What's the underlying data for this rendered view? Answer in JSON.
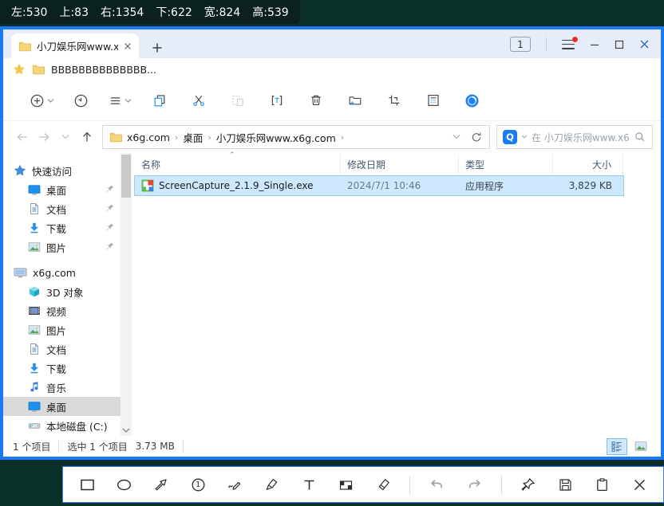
{
  "colors": {
    "background_teal": "#0b3028",
    "window_border_blue": "#1c79f4",
    "selection_row_bg": "#cde8ff",
    "selection_row_border": "#98cef6",
    "accent_icon_blue": "#2e9cf0",
    "search_badge_blue": "#1a7cf2",
    "menu_alert_red": "#e8312a",
    "folder_yellow": "#f6d57a"
  },
  "capture_bar": {
    "parts": [
      "左:530",
      "上:83",
      "右:1354",
      "下:622",
      "宽:824",
      "高:539"
    ]
  },
  "window": {
    "tab": {
      "title": "小刀娱乐网www.x"
    },
    "tab_count_badge": "1",
    "favorites_item": "BBBBBBBBBBBBBB...",
    "toolbar_buttons": [
      {
        "icon": "new-item-icon",
        "chevron": true
      },
      {
        "icon": "recent-icon"
      },
      {
        "icon": "sort-icon",
        "chevron": true
      },
      {
        "icon": "copy-icon"
      },
      {
        "icon": "cut-icon"
      },
      {
        "icon": "paste-icon",
        "disabled": true
      },
      {
        "icon": "rename-icon"
      },
      {
        "icon": "delete-icon"
      },
      {
        "icon": "new-folder-icon"
      },
      {
        "icon": "select-icon"
      },
      {
        "icon": "properties-icon"
      },
      {
        "icon": "app-logo-icon"
      }
    ],
    "address": {
      "crumbs": [
        "x6g.com",
        "桌面",
        "小刀娱乐网www.x6g.com"
      ]
    },
    "search": {
      "badge": "Q",
      "placeholder": "在 小刀娱乐网www.x6..."
    },
    "sidebar": {
      "sections": [
        {
          "label": "快速访问",
          "icon": "quick-access-icon",
          "items": [
            {
              "label": "桌面",
              "icon": "desktop-icon",
              "pinned": true
            },
            {
              "label": "文档",
              "icon": "document-icon",
              "pinned": true
            },
            {
              "label": "下载",
              "icon": "download-icon",
              "pinned": true
            },
            {
              "label": "图片",
              "icon": "pictures-icon",
              "pinned": true
            }
          ]
        },
        {
          "label": "x6g.com",
          "icon": "computer-icon",
          "items": [
            {
              "label": "3D 对象",
              "icon": "objects3d-icon"
            },
            {
              "label": "视频",
              "icon": "video-icon"
            },
            {
              "label": "图片",
              "icon": "pictures-icon"
            },
            {
              "label": "文档",
              "icon": "document-icon"
            },
            {
              "label": "下载",
              "icon": "download-icon"
            },
            {
              "label": "音乐",
              "icon": "music-icon"
            },
            {
              "label": "桌面",
              "icon": "desktop-icon",
              "selected": true
            },
            {
              "label": "本地磁盘 (C:)",
              "icon": "disk-icon"
            }
          ]
        }
      ]
    },
    "files": {
      "columns": [
        "名称",
        "修改日期",
        "类型",
        "大小"
      ],
      "rows": [
        {
          "icon": "exe-file-icon",
          "name": "ScreenCapture_2.1.9_Single.exe",
          "date": "2024/7/1 10:46",
          "type": "应用程序",
          "size": "3,829 KB",
          "selected": true
        }
      ]
    },
    "status": {
      "items_count": "1 个项目",
      "selected_count": "选中 1 个项目",
      "selected_size": "3.73 MB"
    }
  },
  "capture_toolbar": {
    "tools": [
      {
        "icon": "rectangle-icon"
      },
      {
        "icon": "ellipse-icon"
      },
      {
        "icon": "arrow-icon"
      },
      {
        "icon": "number-icon",
        "label": "1"
      },
      {
        "icon": "pen-icon"
      },
      {
        "icon": "marker-icon"
      },
      {
        "icon": "text-icon"
      },
      {
        "icon": "mosaic-icon"
      },
      {
        "icon": "eraser-icon"
      },
      {
        "divider": true
      },
      {
        "icon": "undo-icon",
        "disabled": true
      },
      {
        "icon": "redo-icon",
        "disabled": true
      },
      {
        "divider": true
      },
      {
        "icon": "pin-icon"
      },
      {
        "icon": "save-icon"
      },
      {
        "icon": "clipboard-icon"
      },
      {
        "icon": "close-icon"
      }
    ]
  }
}
